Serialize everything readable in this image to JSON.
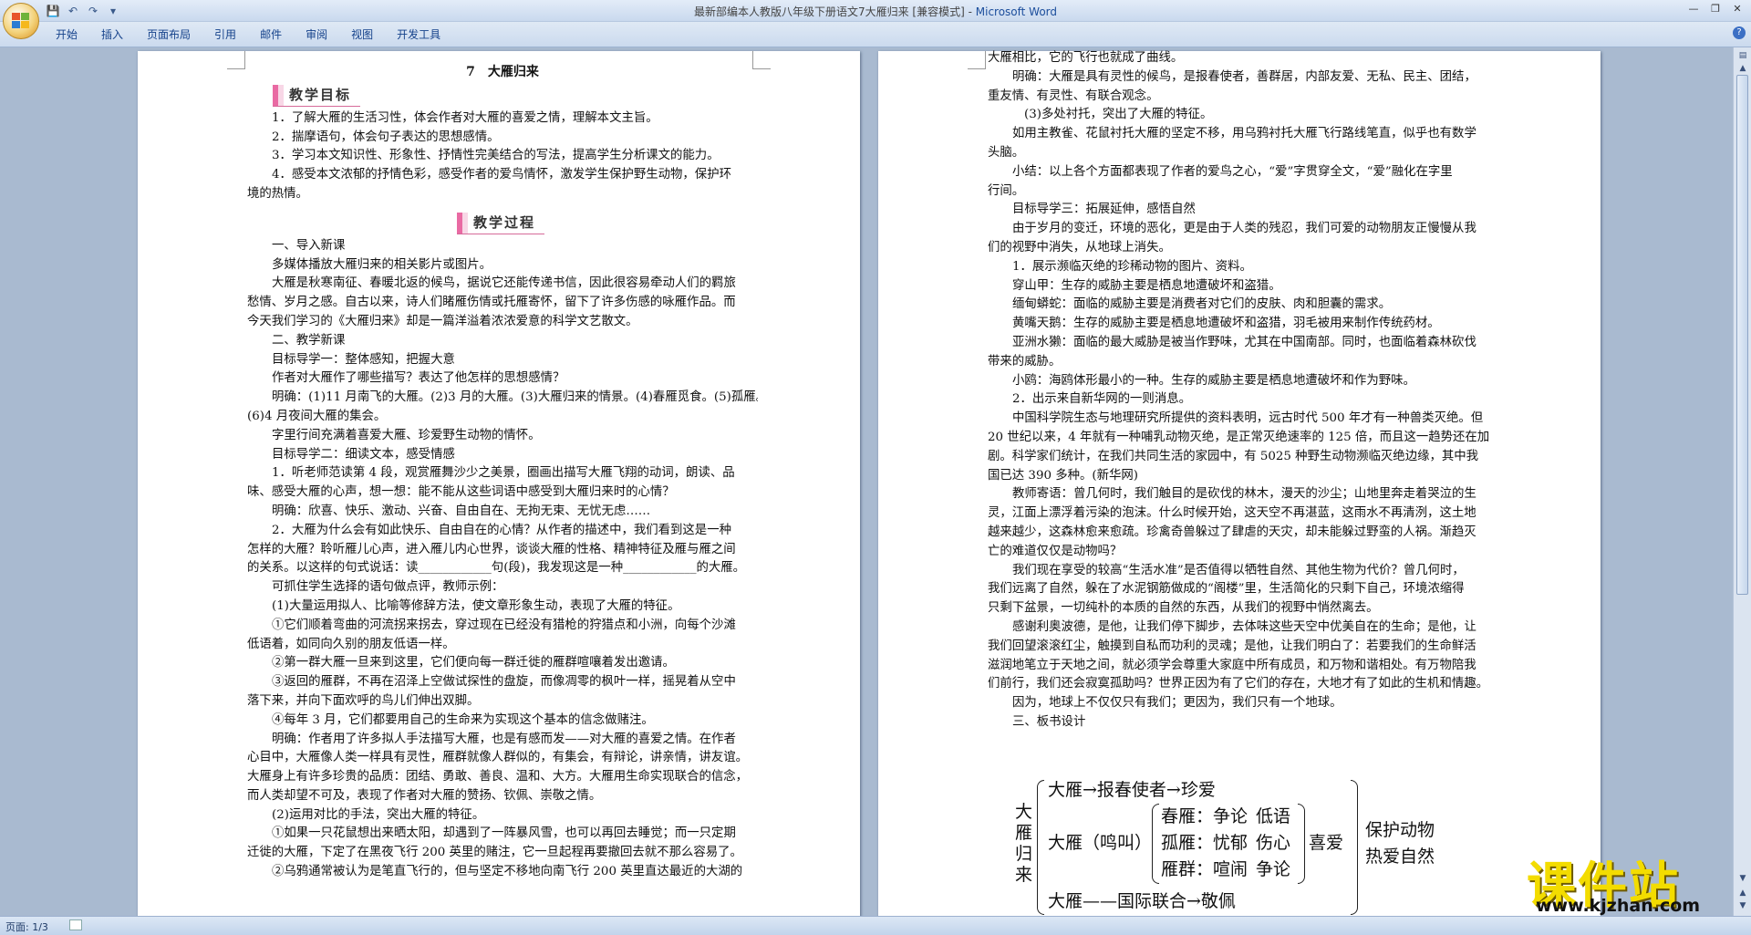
{
  "window": {
    "title_doc": "最新部编本人教版八年级下册语文7大雁归来 [兼容模式] - ",
    "title_app": "Microsoft Word"
  },
  "ribbon": {
    "tabs": [
      "开始",
      "插入",
      "页面布局",
      "引用",
      "邮件",
      "审阅",
      "视图",
      "开发工具"
    ]
  },
  "status": {
    "page": "页面: 1/3"
  },
  "watermark": {
    "text": "课件站",
    "url": "www.kjzhan.com"
  },
  "left_page": {
    "title": "7　大雁归来",
    "banner1": "教学目标",
    "banner2": "教学过程",
    "lines": [
      {
        "t": "1．了解大雁的生活习性，体会作者对大雁的喜爱之情，理解本文主旨。",
        "c": "ind"
      },
      {
        "t": "2．揣摩语句，体会句子表达的思想感情。",
        "c": "ind"
      },
      {
        "t": "3．学习本文知识性、形象性、抒情性完美结合的写法，提高学生分析课文的能力。",
        "c": "ind"
      },
      {
        "t": "4．感受本文浓郁的抒情色彩，感受作者的爱鸟情怀，激发学生保护野生动物，保护环",
        "c": "ind"
      },
      {
        "t": "境的热情。",
        "c": ""
      }
    ],
    "lines2": [
      {
        "t": "一、导入新课",
        "c": "ind"
      },
      {
        "t": "多媒体播放大雁归来的相关影片或图片。",
        "c": "ind"
      },
      {
        "t": "大雁是秋寒南征、春暖北返的候鸟，据说它还能传递书信，因此很容易牵动人们的羁旅",
        "c": "ind"
      },
      {
        "t": "愁情、岁月之感。自古以来，诗人们睹雁伤情或托雁寄怀，留下了许多伤感的咏雁作品。而",
        "c": ""
      },
      {
        "t": "今天我们学习的《大雁归来》却是一篇洋溢着浓浓爱意的科学文艺散文。",
        "c": ""
      },
      {
        "t": "二、教学新课",
        "c": "ind"
      },
      {
        "t": "目标导学一：整体感知，把握大意",
        "c": "ind"
      },
      {
        "t": "作者对大雁作了哪些描写？表达了他怎样的思想感情？",
        "c": "ind"
      },
      {
        "t": "明确：(1)11 月南飞的大雁。(2)3 月的大雁。(3)大雁归来的情景。(4)春雁觅食。(5)孤雁。",
        "c": "ind"
      },
      {
        "t": "(6)4 月夜间大雁的集会。",
        "c": ""
      },
      {
        "t": "字里行间充满着喜爱大雁、珍爱野生动物的情怀。",
        "c": "ind"
      },
      {
        "t": "目标导学二：细读文本，感受情感",
        "c": "ind"
      },
      {
        "t": "1．听老师范读第 4 段，观赏雁舞沙少之美景，圈画出描写大雁飞翔的动词，朗读、品",
        "c": "ind"
      },
      {
        "t": "味、感受大雁的心声，想一想：能不能从这些词语中感受到大雁归来时的心情？",
        "c": ""
      },
      {
        "t": "明确：欣喜、快乐、激动、兴奋、自由自在、无拘无束、无忧无虑……",
        "c": "ind"
      },
      {
        "t": "2．大雁为什么会有如此快乐、自由自在的心情？从作者的描述中，我们看到这是一种",
        "c": "ind"
      },
      {
        "t": "怎样的大雁？聆听雁儿心声，进入雁儿内心世界，谈谈大雁的性格、精神特征及雁与雁之间",
        "c": ""
      },
      {
        "t": "的关系。以这样的句式说话：读____________句(段)，我发现这是一种____________的大雁。",
        "c": ""
      },
      {
        "t": "可抓住学生选择的语句做点评，教师示例：",
        "c": "ind"
      },
      {
        "t": "(1)大量运用拟人、比喻等修辞方法，使文章形象生动，表现了大雁的特征。",
        "c": "ind"
      },
      {
        "t": "①它们顺着弯曲的河流拐来拐去，穿过现在已经没有猎枪的狩猎点和小洲，向每个沙滩",
        "c": "ind"
      },
      {
        "t": "低语着，如同向久别的朋友低语一样。",
        "c": ""
      },
      {
        "t": "②第一群大雁一旦来到这里，它们便向每一群迁徙的雁群喧嚷着发出邀请。",
        "c": "ind"
      },
      {
        "t": "③返回的雁群，不再在沼泽上空做试探性的盘旋，而像凋零的枫叶一样，摇晃着从空中",
        "c": "ind"
      },
      {
        "t": "落下来，并向下面欢呼的鸟儿们伸出双脚。",
        "c": ""
      },
      {
        "t": "④每年 3 月，它们都要用自己的生命来为实现这个基本的信念做赌注。",
        "c": "ind"
      },
      {
        "t": "明确：作者用了许多拟人手法描写大雁，也是有感而发——对大雁的喜爱之情。在作者",
        "c": "ind"
      },
      {
        "t": "心目中，大雁像人类一样具有灵性，雁群就像人群似的，有集会，有辩论，讲亲情，讲友谊。",
        "c": ""
      },
      {
        "t": "大雁身上有许多珍贵的品质：团结、勇敢、善良、温和、大方。大雁用生命实现联合的信念，",
        "c": ""
      },
      {
        "t": "而人类却望不可及，表现了作者对大雁的赞扬、钦佩、崇敬之情。",
        "c": ""
      },
      {
        "t": "(2)运用对比的手法，突出大雁的特征。",
        "c": "ind"
      },
      {
        "t": "①如果一只花鼠想出来晒太阳，却遇到了一阵暴风雪，也可以再回去睡觉；而一只定期",
        "c": "ind"
      },
      {
        "t": "迁徙的大雁，下定了在黑夜飞行 200 英里的赌注，它一旦起程再要撤回去就不那么容易了。",
        "c": ""
      },
      {
        "t": "②乌鸦通常被认为是笔直飞行的，但与坚定不移地向南飞行 200 英里直达最近的大湖的",
        "c": "ind"
      }
    ]
  },
  "right_page": {
    "lines": [
      {
        "t": "大雁相比，它的飞行也就成了曲线。",
        "c": ""
      },
      {
        "t": "明确：大雁是具有灵性的候鸟，是报春使者，善群居，内部友爱、无私、民主、团结，",
        "c": "ind"
      },
      {
        "t": "重友情、有灵性、有联合观念。",
        "c": ""
      },
      {
        "t": " ",
        "c": ""
      },
      {
        "t": "(3)多处衬托，突出了大雁的特征。",
        "c": "ind2"
      },
      {
        "t": "如用主教雀、花鼠衬托大雁的坚定不移，用乌鸦衬托大雁飞行路线笔直，似乎也有数学",
        "c": "ind"
      },
      {
        "t": "头脑。",
        "c": ""
      },
      {
        "t": "小结：以上各个方面都表现了作者的爱鸟之心，“爱”字贯穿全文，“爱”融化在字里",
        "c": "ind"
      },
      {
        "t": "行间。",
        "c": ""
      },
      {
        "t": "目标导学三：拓展延伸，感悟自然",
        "c": "ind"
      },
      {
        "t": "由于岁月的变迁，环境的恶化，更是由于人类的残忍，我们可爱的动物朋友正慢慢从我",
        "c": "ind"
      },
      {
        "t": "们的视野中消失，从地球上消失。",
        "c": ""
      },
      {
        "t": "1．展示濒临灭绝的珍稀动物的图片、资料。",
        "c": "ind"
      },
      {
        "t": "穿山甲：生存的威胁主要是栖息地遭破坏和盗猎。",
        "c": "ind"
      },
      {
        "t": "缅甸蟒蛇：面临的威胁主要是消费者对它们的皮肤、肉和胆囊的需求。",
        "c": "ind"
      },
      {
        "t": "黄嘴天鹅：生存的威胁主要是栖息地遭破坏和盗猎，羽毛被用来制作传统药材。",
        "c": "ind"
      },
      {
        "t": "亚洲水獭：面临的最大威胁是被当作野味，尤其在中国南部。同时，也面临着森林砍伐",
        "c": "ind"
      },
      {
        "t": "带来的威胁。",
        "c": ""
      },
      {
        "t": "小鸥：海鸥体形最小的一种。生存的威胁主要是栖息地遭破坏和作为野味。",
        "c": "ind"
      },
      {
        "t": "2．出示来自新华网的一则消息。",
        "c": "ind"
      },
      {
        "t": "中国科学院生态与地理研究所提供的资料表明，远古时代 500 年才有一种兽类灭绝。但",
        "c": "ind"
      },
      {
        "t": "20 世纪以来，4 年就有一种哺乳动物灭绝，是正常灭绝速率的 125 倍，而且这一趋势还在加",
        "c": ""
      },
      {
        "t": "剧。科学家们统计，在我们共同生活的家园中，有 5025 种野生动物濒临灭绝边缘，其中我",
        "c": ""
      },
      {
        "t": "国已达 390 多种。(新华网)",
        "c": ""
      },
      {
        "t": "教师寄语：曾几何时，我们触目的是砍伐的林木，漫天的沙尘；山地里奔走着哭泣的生",
        "c": "ind"
      },
      {
        "t": "灵，江面上漂浮着污染的泡沫。什么时候开始，这天空不再湛蓝，这雨水不再清洌，这土地",
        "c": ""
      },
      {
        "t": "越来越少，这森林愈来愈疏。珍禽奇兽躲过了肆虐的天灾，却未能躲过野蛮的人祸。渐趋灭",
        "c": ""
      },
      {
        "t": "亡的难道仅仅是动物吗？",
        "c": ""
      },
      {
        "t": "我们现在享受的较高“生活水准”是否值得以牺牲自然、其他生物为代价？曾几何时，",
        "c": "ind"
      },
      {
        "t": "我们远离了自然，躲在了水泥钢筋做成的“阁楼”里，生活简化的只剩下自己，环境浓缩得",
        "c": ""
      },
      {
        "t": "只剩下盆景，一切纯朴的本质的自然的东西，从我们的视野中悄然离去。",
        "c": ""
      },
      {
        "t": "感谢利奥波德，是他，让我们停下脚步，去体味这些天空中优美自在的生命；是他，让",
        "c": "ind"
      },
      {
        "t": "我们回望滚滚红尘，触摸到自私而功利的灵魂；是他，让我们明白了：若要我们的生命鲜活",
        "c": ""
      },
      {
        "t": "滋润地笔立于天地之间，就必须学会尊重大家庭中所有成员，和万物和谐相处。有万物陪我",
        "c": ""
      },
      {
        "t": "们前行，我们还会寂寞孤助吗？世界正因为有了它们的存在，大地才有了如此的生机和情趣。",
        "c": ""
      },
      {
        "t": "因为，地球上不仅仅只有我们；更因为，我们只有一个地球。",
        "c": "ind"
      },
      {
        "t": "三、板书设计",
        "c": "ind"
      }
    ],
    "board": {
      "main": "大雁归来",
      "r1": "大雁→报春使者→珍爱",
      "r2a": "大雁（鸣叫）",
      "r2b": "春雁：争论",
      "r2c": "孤雁：忧郁",
      "r2d": "雁群：喧闹",
      "r3a": "低语",
      "r3b": "伤心",
      "r3c": "争论",
      "joy": "喜爱",
      "p1": "保护动物",
      "p2": "热爱自然",
      "r4": "大雁——国际联合→敬佩"
    }
  }
}
